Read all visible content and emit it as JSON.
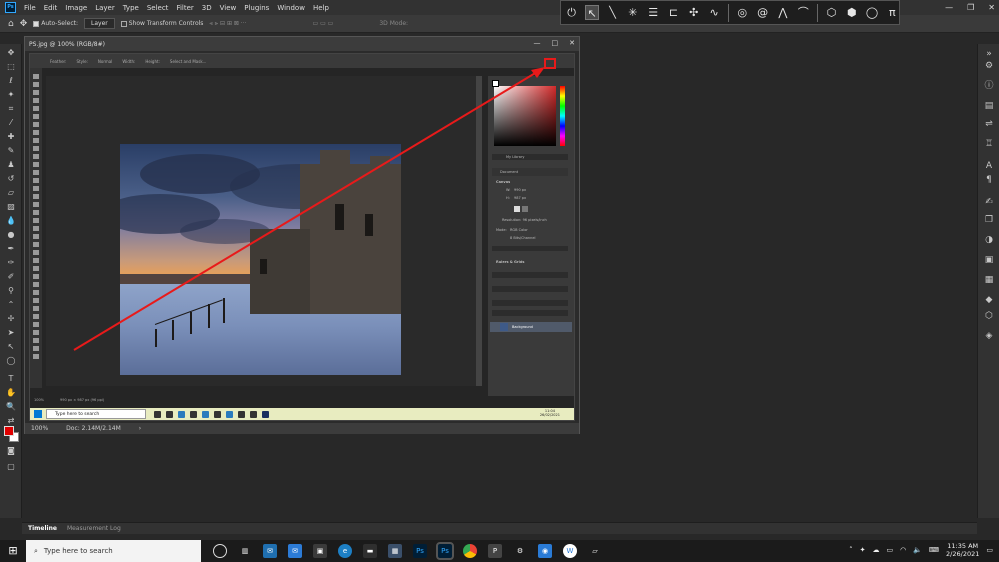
{
  "menu": {
    "logo": "Ps",
    "items": [
      "File",
      "Edit",
      "Image",
      "Layer",
      "Type",
      "Select",
      "Filter",
      "3D",
      "View",
      "Plugins",
      "Window",
      "Help"
    ],
    "window_controls": [
      "—",
      "❐",
      "✕"
    ]
  },
  "options_bar": {
    "auto_select_label": "Auto-Select:",
    "auto_select_target": "Layer",
    "show_transform_label": "Show Transform Controls",
    "mode_3d_label": "3D Mode:"
  },
  "document": {
    "title": "PS.jpg @ 100% (RGB/8#)",
    "zoom": "100%",
    "doc_size": "Doc: 2.14M/2.14M",
    "window_controls": [
      "—",
      "□",
      "✕"
    ]
  },
  "nested_screenshot": {
    "options_items": [
      "Feather:",
      "Style:",
      "Normal",
      "Width:",
      "Height:",
      "Select and Mask..."
    ],
    "panel": {
      "library_label": "My Library",
      "document_label": "Document",
      "canvas_label": "Canvas",
      "w_label": "W:",
      "w_value": "990 px",
      "h_label": "H:",
      "h_value": "987 px",
      "resolution": "Resolution: 96 pixels/inch",
      "mode_label": "Mode:",
      "mode_value": "RGB Color",
      "bit_depth": "8 Bits/Channel",
      "rulers_label": "Rulers & Grids",
      "layer_name": "Background"
    },
    "status_text": "990 px × 987 px (96 ppi)",
    "zoom": "100%",
    "taskbar_search": "Type here to search",
    "clock_time": "11:04",
    "clock_date": "26/02/2021"
  },
  "timeline": {
    "tabs": [
      "Timeline",
      "Measurement Log"
    ]
  },
  "taskbar": {
    "search_placeholder": "Type here to search",
    "clock_time": "11:35 AM",
    "clock_date": "2/26/2021"
  },
  "colors": {
    "accent_blue": "#31a8ff",
    "annotation_red": "#e81a1a",
    "foreground_swatch": "#e00000",
    "background_swatch": "#ffffff"
  },
  "icons": {
    "overlay_toolbar": [
      "power-icon",
      "cursor-pen-icon",
      "line-icon",
      "sparkle-icon",
      "align-icon",
      "frame-icon",
      "mesh-icon",
      "curve-icon",
      "spiral-icon",
      "swirl-icon",
      "angle-icon",
      "wave-icon",
      "cube-icon",
      "hexagon-icon",
      "circle-icon",
      "stool-icon"
    ],
    "right_strip": [
      "expand-icon",
      "info-icon",
      "history-icon",
      "adjust-icon",
      "properties-icon",
      "character-icon",
      "paragraph-icon",
      "brush-icon",
      "layers-icon",
      "channels-icon",
      "3d-icon",
      "shapes-icon"
    ]
  }
}
